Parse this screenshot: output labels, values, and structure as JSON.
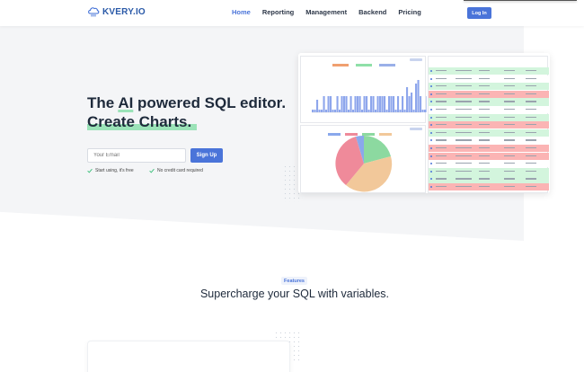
{
  "brand": {
    "logo_text": "KVERY.IO",
    "accent": "#4a74d9",
    "highlight": "#9be3b8"
  },
  "nav": {
    "links": [
      {
        "label": "Home",
        "active": true
      },
      {
        "label": "Reporting",
        "active": false
      },
      {
        "label": "Management",
        "active": false
      },
      {
        "label": "Backend",
        "active": false
      },
      {
        "label": "Pricing",
        "active": false
      }
    ],
    "login_label": "Log In"
  },
  "hero": {
    "headline_part1": "The ",
    "headline_ai": "AI",
    "headline_part2": " powered SQL editor.",
    "headline_line2": "Create Charts.",
    "email_placeholder": "Your Email",
    "signup_label": "Sign Up",
    "checks": [
      "Start using, it's free",
      "No credit card required"
    ]
  },
  "dashboard_preview": {
    "legend_colors": [
      "#f0a070",
      "#8fe0a8",
      "#9ab0e8"
    ],
    "bar_color": "#8ea6ec",
    "pie_colors": [
      "#ef8a9a",
      "#8cd9a0",
      "#f2c89a",
      "#8aa8ec"
    ],
    "row_colors": [
      "#d3f5dd",
      "#ffffff",
      "#d3f5dd",
      "#fbb4b4",
      "#d3f5dd",
      "#ffffff",
      "#d3f5dd",
      "#fbb4b4",
      "#d3f5dd",
      "#ffffff",
      "#fbb4b4",
      "#fbb4b4",
      "#ffffff",
      "#d3f5dd",
      "#d3f5dd",
      "#fbb4b4"
    ]
  },
  "features": {
    "badge": "Features",
    "title": "Supercharge your SQL with variables."
  }
}
